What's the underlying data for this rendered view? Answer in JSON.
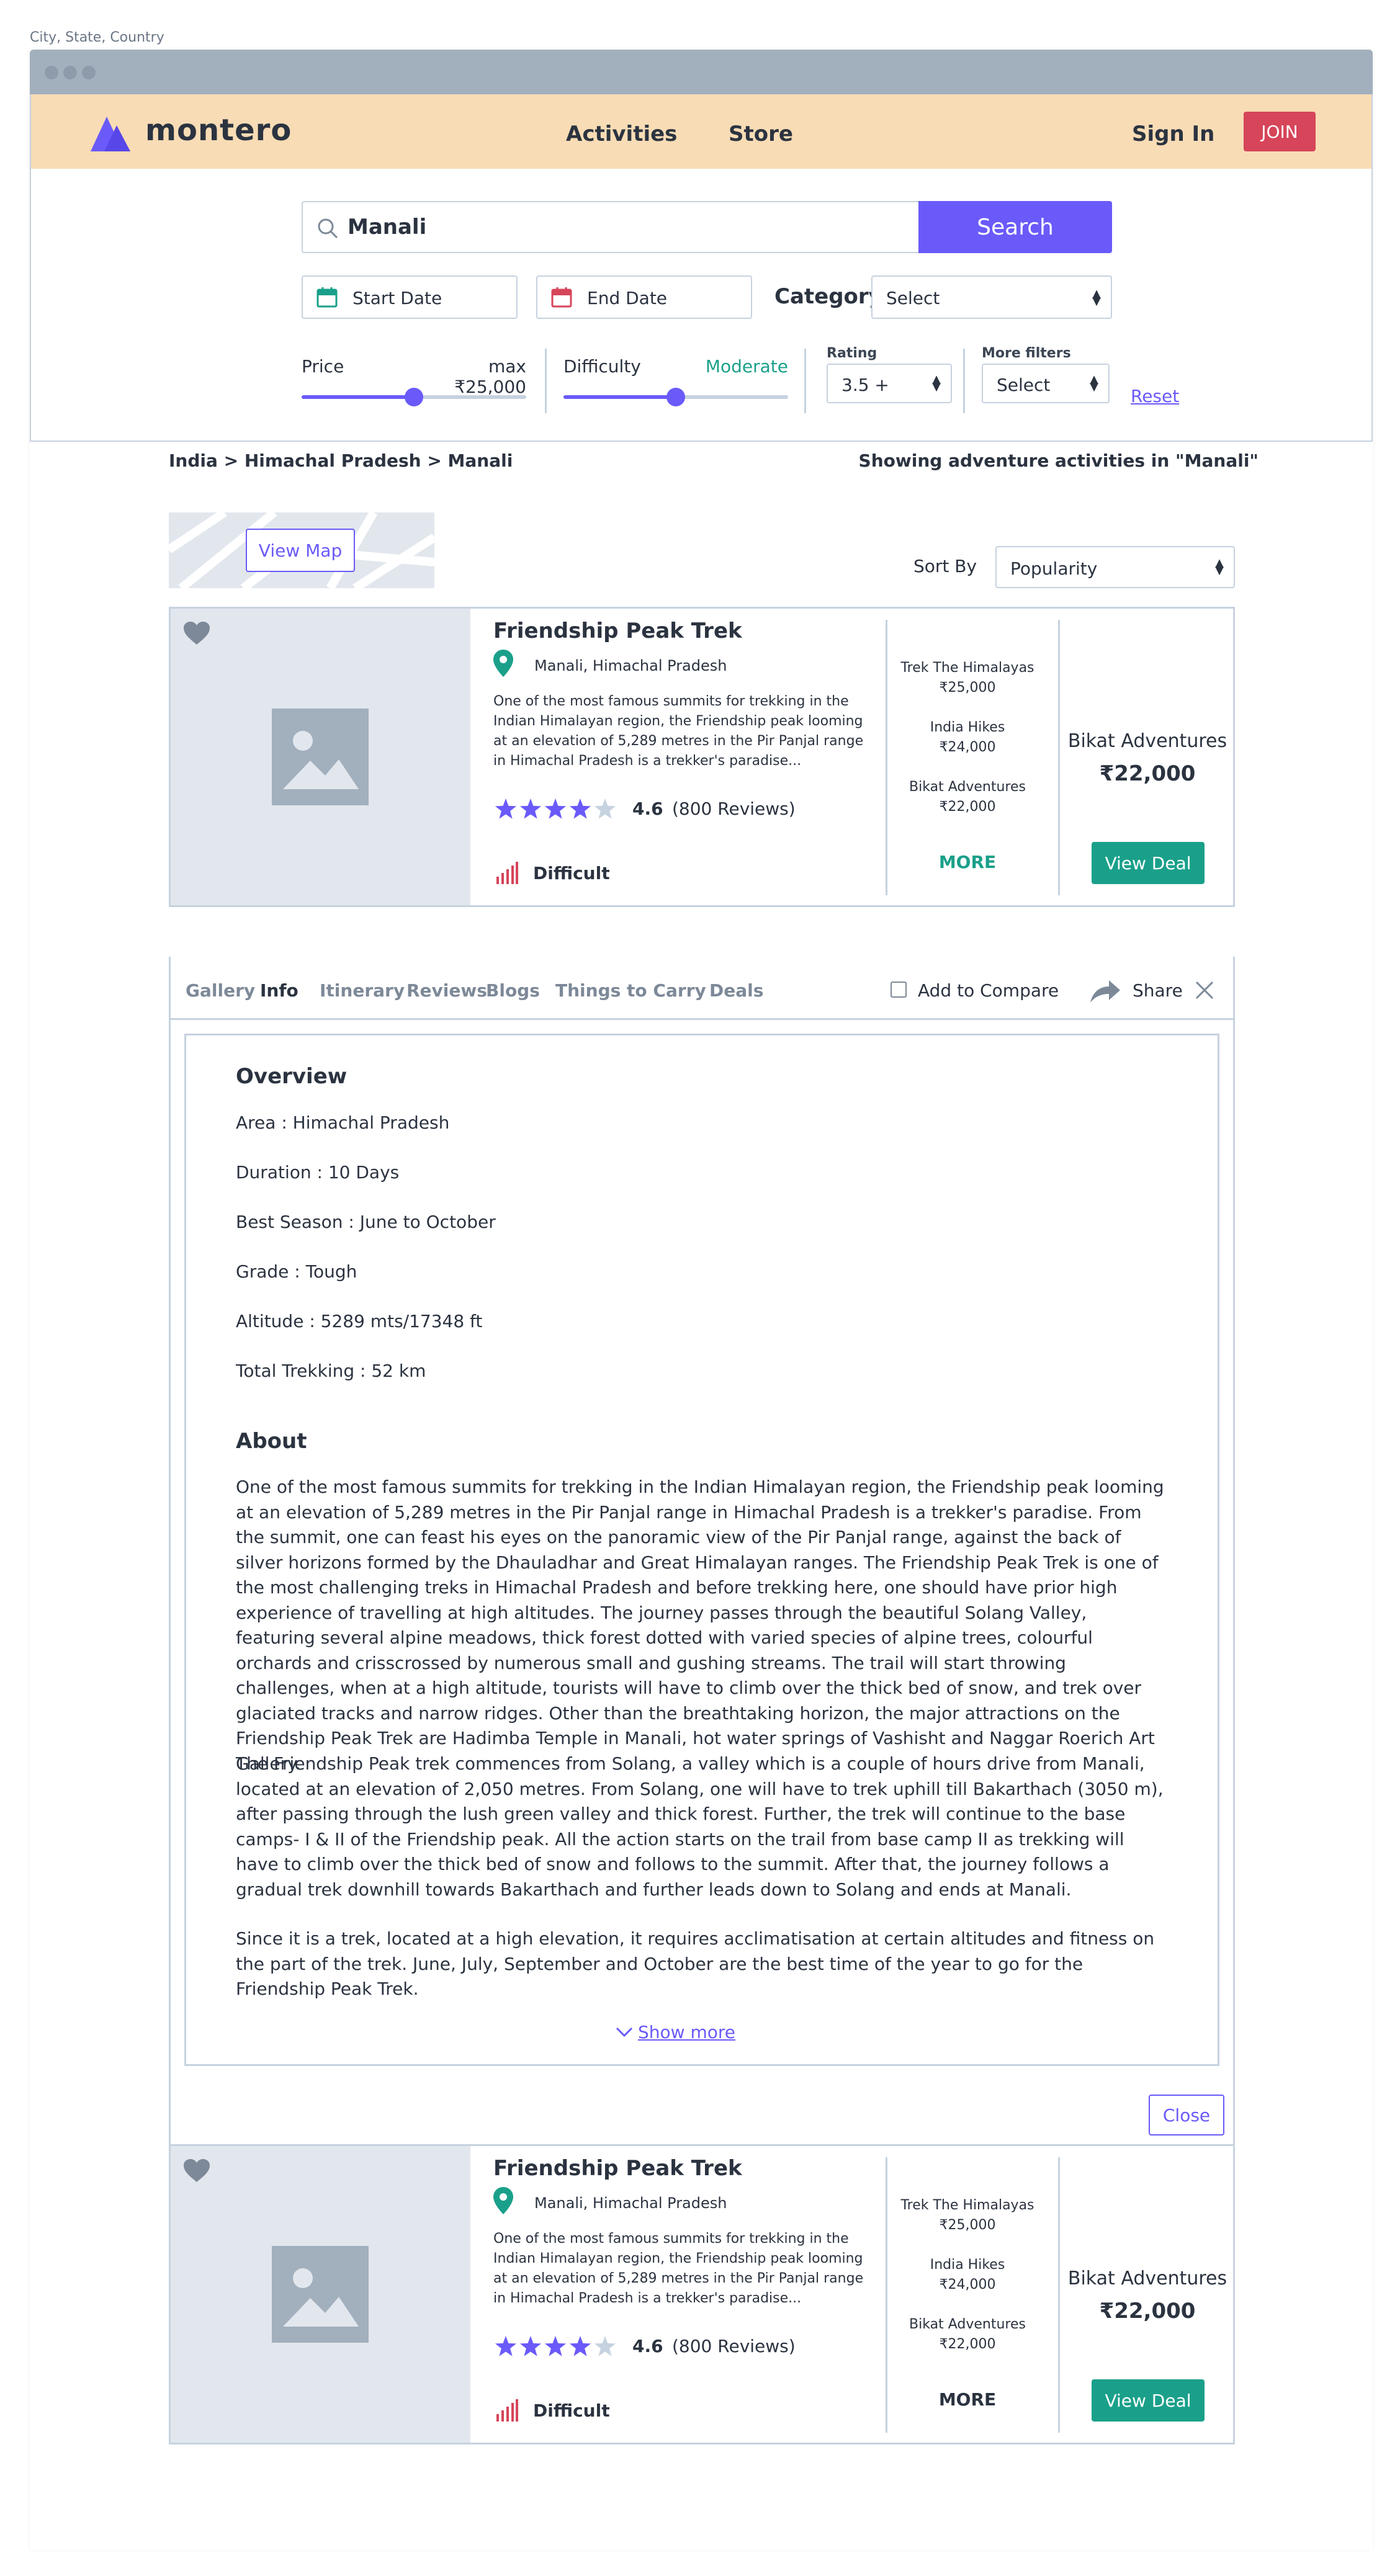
{
  "caption": "City, State, Country",
  "brand": {
    "name": "montero",
    "accent": "#6a5af9",
    "join_color": "#d6455a",
    "nav_bg": "#f8dcb5"
  },
  "nav": {
    "activities": "Activities",
    "store": "Store",
    "sign_in": "Sign In",
    "join": "JOIN"
  },
  "search": {
    "value": "Manali",
    "button": "Search",
    "start_date": "Start Date",
    "end_date": "End Date",
    "category_label": "Category",
    "category_value": "Select",
    "price_label": "Price",
    "price_max": "max ₹25,000",
    "price_level": 0.5,
    "difficulty_label": "Difficulty",
    "difficulty_value": "Moderate",
    "difficulty_level": 0.5,
    "rating_label": "Rating",
    "rating_value": "3.5 +",
    "more_filters_label": "More filters",
    "more_filters_value": "Select",
    "reset": "Reset"
  },
  "breadcrumb": "India > Himachal Pradesh > Manali",
  "showing": "Showing adventure activities in \"Manali\"",
  "map": {
    "button": "View Map"
  },
  "sort": {
    "label": "Sort By",
    "value": "Popularity"
  },
  "cards": [
    {
      "title": "Friendship Peak Trek",
      "location": "Manali, Himachal Pradesh",
      "description": "One of the most famous summits for trekking in the Indian Himalayan region, the Friendship peak looming at an elevation of 5,289 metres in the Pir Panjal range in Himachal Pradesh is a trekker's paradise...",
      "rating": "4.6",
      "stars": 4,
      "reviews": "(800 Reviews)",
      "difficulty": "Difficult",
      "vendors": [
        {
          "name": "Trek The Himalayas",
          "price": "₹25,000"
        },
        {
          "name": "India Hikes",
          "price": "₹24,000"
        },
        {
          "name": "Bikat Adventures",
          "price": "₹22,000"
        }
      ],
      "more": "MORE",
      "more_color": "#1aa08a",
      "best_vendor": "Bikat Adventures",
      "best_price": "₹22,000",
      "deal_button": "View Deal"
    },
    {
      "title": "Friendship Peak Trek",
      "location": "Manali, Himachal Pradesh",
      "description": "One of the most famous summits for trekking in the Indian Himalayan region, the Friendship peak looming at an elevation of 5,289 metres in the Pir Panjal range in Himachal Pradesh is a trekker's paradise...",
      "rating": "4.6",
      "stars": 4,
      "reviews": "(800 Reviews)",
      "difficulty": "Difficult",
      "vendors": [
        {
          "name": "Trek The Himalayas",
          "price": "₹25,000"
        },
        {
          "name": "India Hikes",
          "price": "₹24,000"
        },
        {
          "name": "Bikat Adventures",
          "price": "₹22,000"
        }
      ],
      "more": "MORE",
      "more_color": "#2b3340",
      "best_vendor": "Bikat Adventures",
      "best_price": "₹22,000",
      "deal_button": "View Deal"
    }
  ],
  "detail": {
    "tabs": [
      "Gallery",
      "Info",
      "Itinerary",
      "Reviews",
      "Blogs",
      "Things to Carry",
      "Deals"
    ],
    "active_tab": "Info",
    "compare": "Add to Compare",
    "share": "Share",
    "overview_title": "Overview",
    "facts": [
      "Area : Himachal Pradesh",
      "Duration : 10 Days",
      "Best Season : June to October",
      "Grade  : Tough",
      "Altitude : 5289 mts/17348 ft",
      "Total Trekking : 52 km"
    ],
    "about_title": "About",
    "about": [
      "One of the most famous summits for trekking in the Indian Himalayan region, the Friendship peak looming at an elevation of 5,289 metres in the Pir Panjal range in Himachal Pradesh is a trekker's paradise. From the summit, one can feast his eyes on the panoramic view of the Pir Panjal range, against the back of silver horizons formed by the Dhauladhar and Great Himalayan ranges. The Friendship Peak Trek is one of the most challenging treks in Himachal Pradesh and before trekking here, one should have prior high experience of travelling at high altitudes. The journey passes through the beautiful Solang Valley, featuring several alpine meadows, thick forest dotted with varied species of alpine trees, colourful orchards and crisscrossed by numerous small and gushing streams. The trail will start throwing challenges, when at a high altitude, tourists will have to climb over the thick bed of snow, and trek over glaciated tracks and narrow ridges. Other than the breathtaking horizon, the major attractions on the Friendship Peak Trek are Hadimba Temple in Manali, hot water springs of Vashisht and Naggar Roerich Art Gallery.",
      "The Friendship Peak trek commences from Solang, a valley which is a couple of hours drive from Manali, located at an elevation of 2,050 metres. From Solang, one will have to trek uphill till Bakarthach (3050 m), after passing through the lush green valley and thick forest. Further, the trek will continue to the base camps- I & II of the Friendship peak. All the action starts on the trail from base camp II as trekking will have to climb over the thick bed of snow and follows to the summit. After that, the journey follows a gradual trek downhill towards Bakarthach and further leads down to Solang and ends at Manali.",
      "Since it is a trek, located at a high elevation, it requires acclimatisation at certain altitudes and fitness on the part of the trek. June, July, September and October are the best time of the year to go for the Friendship Peak Trek."
    ],
    "show_more": "Show more",
    "close": "Close"
  }
}
